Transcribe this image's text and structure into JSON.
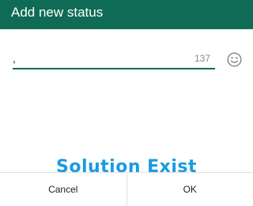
{
  "header": {
    "title": "Add new status",
    "background_color": "#0f6b55"
  },
  "input": {
    "value": ",",
    "char_counter": "137",
    "accent_color": "#0f6b55"
  },
  "emoji": {
    "icon": "smiley-face-icon"
  },
  "watermark": {
    "text": "Solution Exist",
    "color": "#1a9be0"
  },
  "buttons": {
    "cancel_label": "Cancel",
    "ok_label": "OK"
  }
}
